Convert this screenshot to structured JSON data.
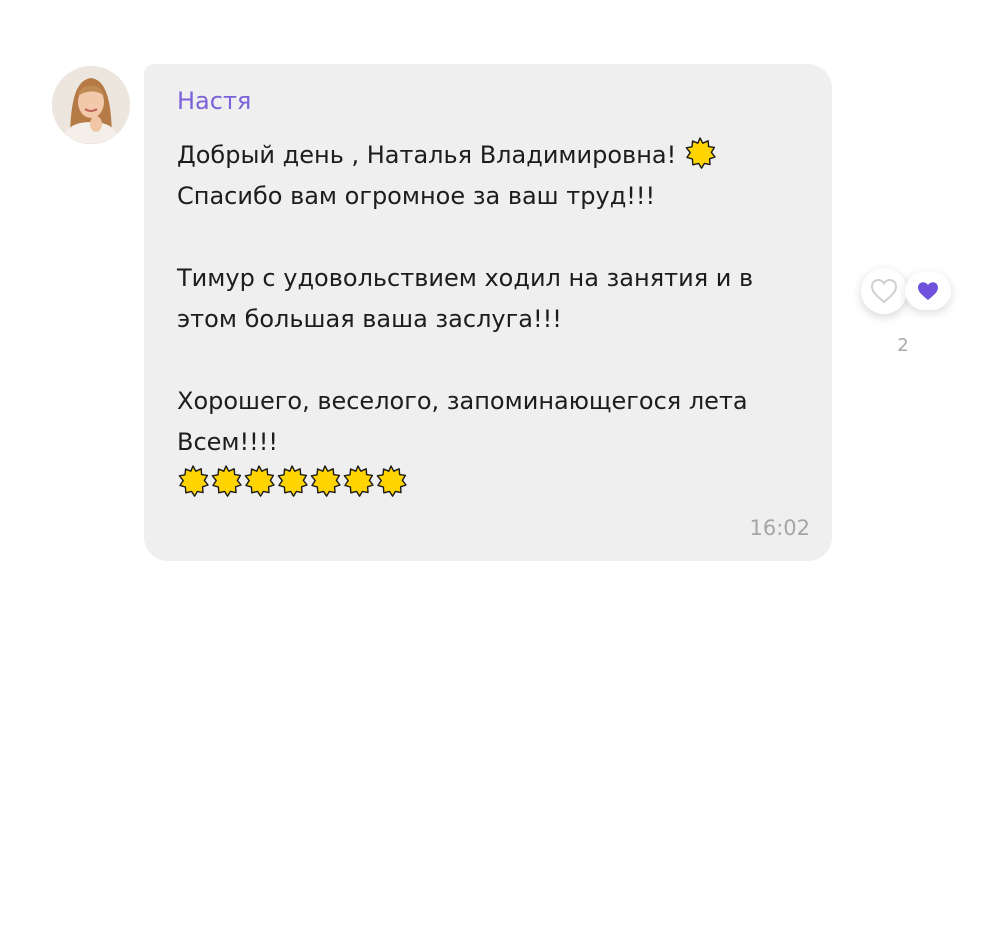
{
  "message": {
    "sender": "Настя",
    "lines": [
      "Добрый день , Наталья Владимировна!",
      "Спасибо вам огромное за ваш труд!!!",
      "",
      "Тимур с удовольствием ходил на занятия и в",
      "этом большая ваша заслуга!!!",
      "",
      "Хорошего, веселого, запоминающегося лета",
      "Всем!!!!"
    ],
    "emoji": "sun-icon",
    "emoji_row_count": 7,
    "time": "16:02"
  },
  "reactions": {
    "like_icon": "heart-outline-icon",
    "reaction_icon": "heart-filled-icon",
    "count": "2"
  },
  "colors": {
    "sender_name": "#7b62d8",
    "bubble_bg": "#efefef",
    "heart_filled": "#6f52dc",
    "emoji_fill": "#ffd400"
  }
}
